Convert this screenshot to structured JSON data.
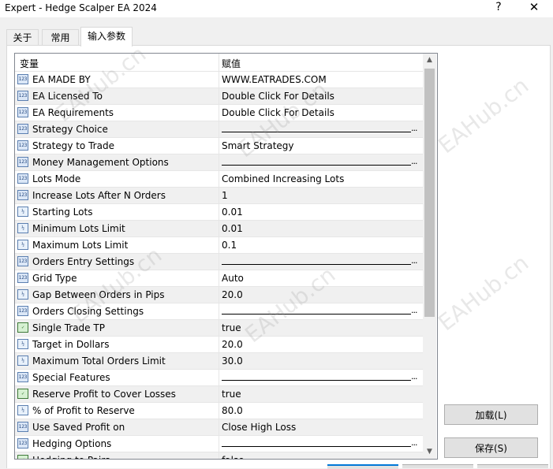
{
  "window": {
    "title": "Expert - Hedge Scalper EA 2024",
    "help": "?",
    "close": "✕"
  },
  "tabs": [
    "关于",
    "常用",
    "输入参数"
  ],
  "table": {
    "col_variable": "变量",
    "col_value": "赋值",
    "rows": [
      {
        "icon": "123",
        "type": "int",
        "name": "EA MADE BY",
        "value": "WWW.EATRADES.COM"
      },
      {
        "icon": "123",
        "type": "int",
        "name": "EA Licensed To",
        "value": "Double Click For Details"
      },
      {
        "icon": "123",
        "type": "int",
        "name": "EA Requirements",
        "value": "Double Click For Details"
      },
      {
        "icon": "123",
        "type": "int",
        "name": "Strategy Choice",
        "value": "",
        "separator": true
      },
      {
        "icon": "123",
        "type": "int",
        "name": "Strategy to Trade",
        "value": "Smart Strategy"
      },
      {
        "icon": "123",
        "type": "int",
        "name": "Money Management Options",
        "value": "",
        "separator": true
      },
      {
        "icon": "123",
        "type": "int",
        "name": "Lots Mode",
        "value": "Combined Increasing Lots"
      },
      {
        "icon": "123",
        "type": "int",
        "name": "Increase Lots After N Orders",
        "value": "1"
      },
      {
        "icon": "½",
        "type": "frac",
        "name": "Starting Lots",
        "value": "0.01"
      },
      {
        "icon": "½",
        "type": "frac",
        "name": "Minimum Lots Limit",
        "value": "0.01"
      },
      {
        "icon": "½",
        "type": "frac",
        "name": "Maximum Lots Limit",
        "value": "0.1"
      },
      {
        "icon": "123",
        "type": "int",
        "name": "Orders Entry Settings",
        "value": "",
        "separator": true
      },
      {
        "icon": "123",
        "type": "int",
        "name": "Grid Type",
        "value": "Auto"
      },
      {
        "icon": "½",
        "type": "frac",
        "name": "Gap Between Orders in Pips",
        "value": "20.0"
      },
      {
        "icon": "123",
        "type": "int",
        "name": "Orders Closing Settings",
        "value": "",
        "separator": true
      },
      {
        "icon": "✓",
        "type": "bool",
        "name": "Single Trade TP",
        "value": "true"
      },
      {
        "icon": "½",
        "type": "frac",
        "name": "Target in Dollars",
        "value": "20.0"
      },
      {
        "icon": "½",
        "type": "frac",
        "name": "Maximum Total Orders Limit",
        "value": "30.0"
      },
      {
        "icon": "123",
        "type": "int",
        "name": "Special Features",
        "value": "",
        "separator": true
      },
      {
        "icon": "✓",
        "type": "bool",
        "name": "Reserve Profit to Cover Losses",
        "value": "true"
      },
      {
        "icon": "½",
        "type": "frac",
        "name": "% of Profit to Reserve",
        "value": "80.0"
      },
      {
        "icon": "123",
        "type": "int",
        "name": "Use Saved Profit on",
        "value": "Close High Loss"
      },
      {
        "icon": "123",
        "type": "int",
        "name": "Hedging Options",
        "value": "",
        "separator": true
      },
      {
        "icon": "✓",
        "type": "bool",
        "name": "Hedging to Pairs",
        "value": "false"
      }
    ],
    "separator_dots": "...",
    "scroll_up": "▲",
    "scroll_down": "▼"
  },
  "buttons": {
    "load": "加载(L)",
    "save": "保存(S)"
  },
  "watermark": "EAHub.cn"
}
